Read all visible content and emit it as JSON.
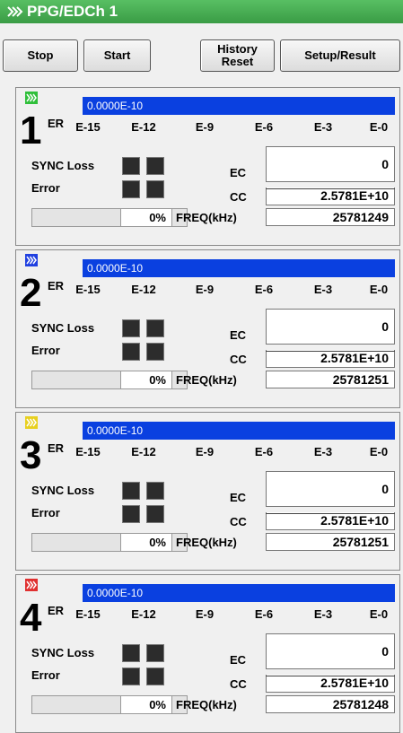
{
  "title": "PPG/EDCh 1",
  "toolbar": {
    "stop": "Stop",
    "start": "Start",
    "history_reset_line1": "History",
    "history_reset_line2": "Reset",
    "setup_result": "Setup/Result"
  },
  "labels": {
    "er": "ER",
    "sync_loss": "SYNC Loss",
    "error": "Error",
    "ec": "EC",
    "cc": "CC",
    "freq": "FREQ(kHz)"
  },
  "scale_ticks": [
    "E-15",
    "E-12",
    "E-9",
    "E-6",
    "E-3",
    "E-0"
  ],
  "channels": [
    {
      "num": "1",
      "icon_color": "#2fbf3a",
      "er_value": "0.0000E-10",
      "ec": "0",
      "cc": "2.5781E+10",
      "freq": "25781249",
      "progress": "0%"
    },
    {
      "num": "2",
      "icon_color": "#2040e0",
      "er_value": "0.0000E-10",
      "ec": "0",
      "cc": "2.5781E+10",
      "freq": "25781251",
      "progress": "0%"
    },
    {
      "num": "3",
      "icon_color": "#e8d020",
      "er_value": "0.0000E-10",
      "ec": "0",
      "cc": "2.5781E+10",
      "freq": "25781251",
      "progress": "0%"
    },
    {
      "num": "4",
      "icon_color": "#e03030",
      "er_value": "0.0000E-10",
      "ec": "0",
      "cc": "2.5781E+10",
      "freq": "25781248",
      "progress": "0%"
    }
  ],
  "colors": {
    "title_bar": "#3a9c45",
    "er_bar": "#0a40e0",
    "led_off": "#2c2c2c"
  }
}
